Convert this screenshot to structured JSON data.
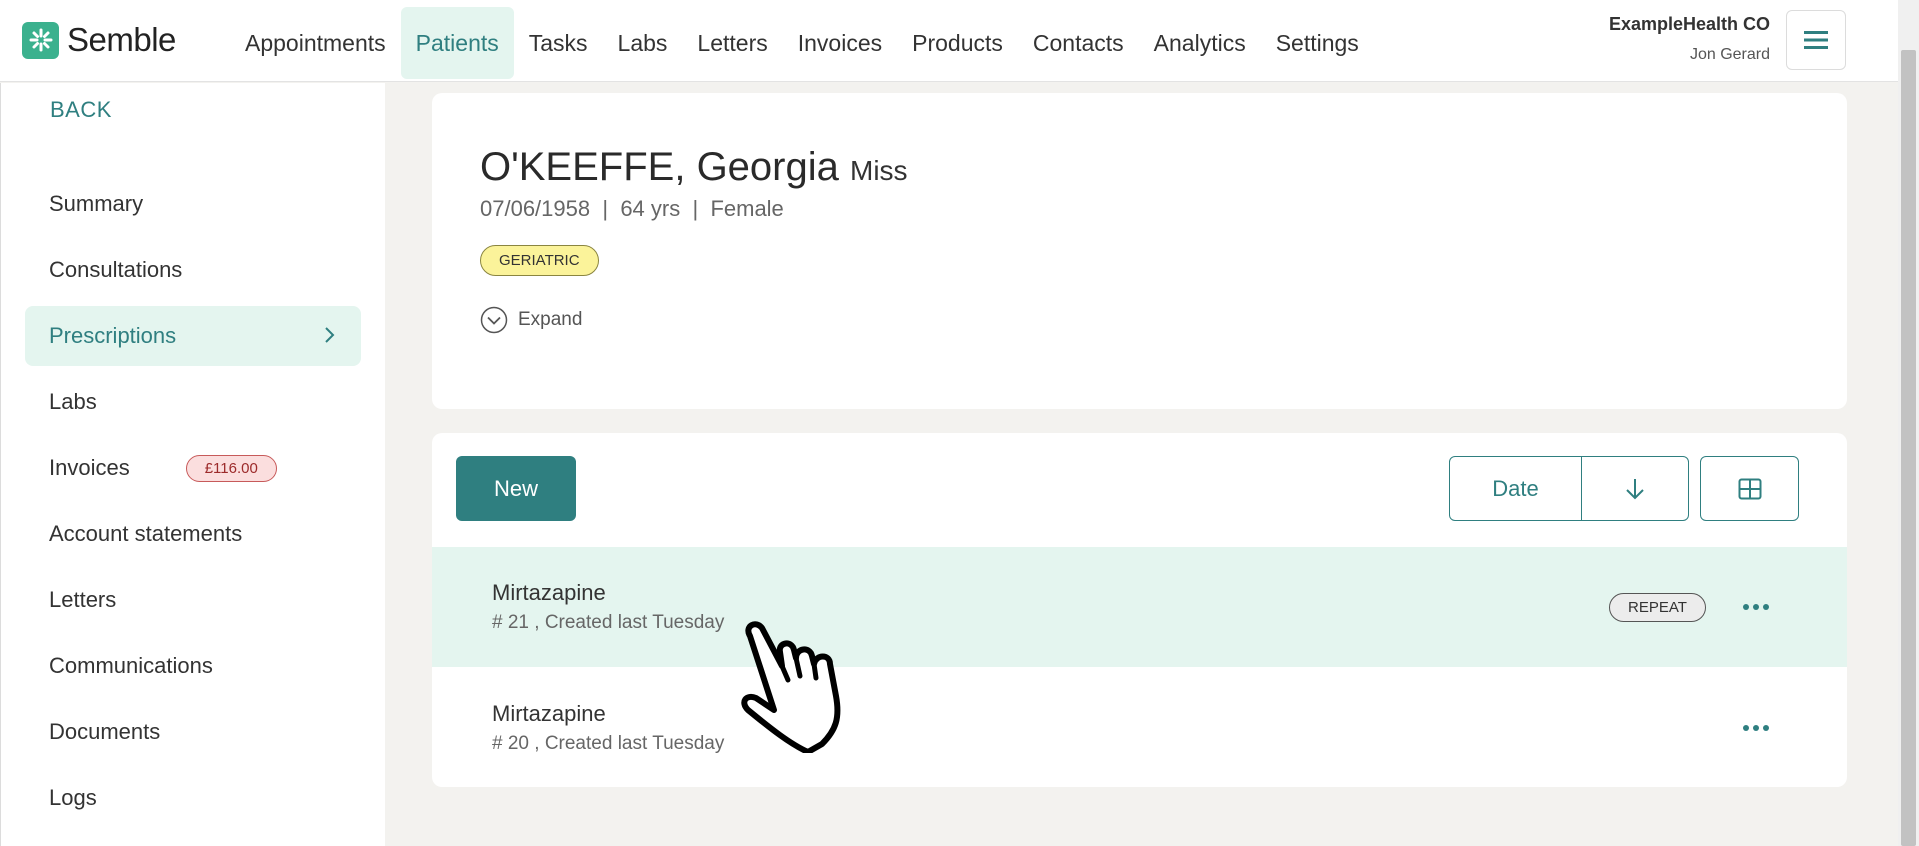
{
  "app": {
    "name": "Semble"
  },
  "nav": [
    {
      "label": "Appointments",
      "active": false
    },
    {
      "label": "Patients",
      "active": true
    },
    {
      "label": "Tasks",
      "active": false
    },
    {
      "label": "Labs",
      "active": false
    },
    {
      "label": "Letters",
      "active": false
    },
    {
      "label": "Invoices",
      "active": false
    },
    {
      "label": "Products",
      "active": false
    },
    {
      "label": "Contacts",
      "active": false
    },
    {
      "label": "Analytics",
      "active": false
    },
    {
      "label": "Settings",
      "active": false
    }
  ],
  "account": {
    "org": "ExampleHealth CO",
    "user": "Jon Gerard"
  },
  "sidebar": {
    "back_label": "BACK",
    "items": [
      {
        "label": "Summary"
      },
      {
        "label": "Consultations"
      },
      {
        "label": "Prescriptions",
        "active": true
      },
      {
        "label": "Labs"
      },
      {
        "label": "Invoices",
        "badge": "£116.00"
      },
      {
        "label": "Account statements"
      },
      {
        "label": "Letters"
      },
      {
        "label": "Communications"
      },
      {
        "label": "Documents"
      },
      {
        "label": "Logs"
      }
    ]
  },
  "patient": {
    "name": "O'KEEFFE, Georgia",
    "title": "Miss",
    "dob": "07/06/1958",
    "age": "64 yrs",
    "sex": "Female",
    "tag": "GERIATRIC",
    "expand_label": "Expand"
  },
  "toolbar": {
    "new_label": "New",
    "sort_label": "Date"
  },
  "prescriptions": [
    {
      "name": "Mirtazapine",
      "meta": "# 21 , Created last Tuesday",
      "badge": "REPEAT"
    },
    {
      "name": "Mirtazapine",
      "meta": "# 20 , Created last Tuesday",
      "badge": ""
    }
  ],
  "colors": {
    "brand": "#2f7f80",
    "accent": "#3bb18e",
    "highlight": "#e4f5ef"
  }
}
